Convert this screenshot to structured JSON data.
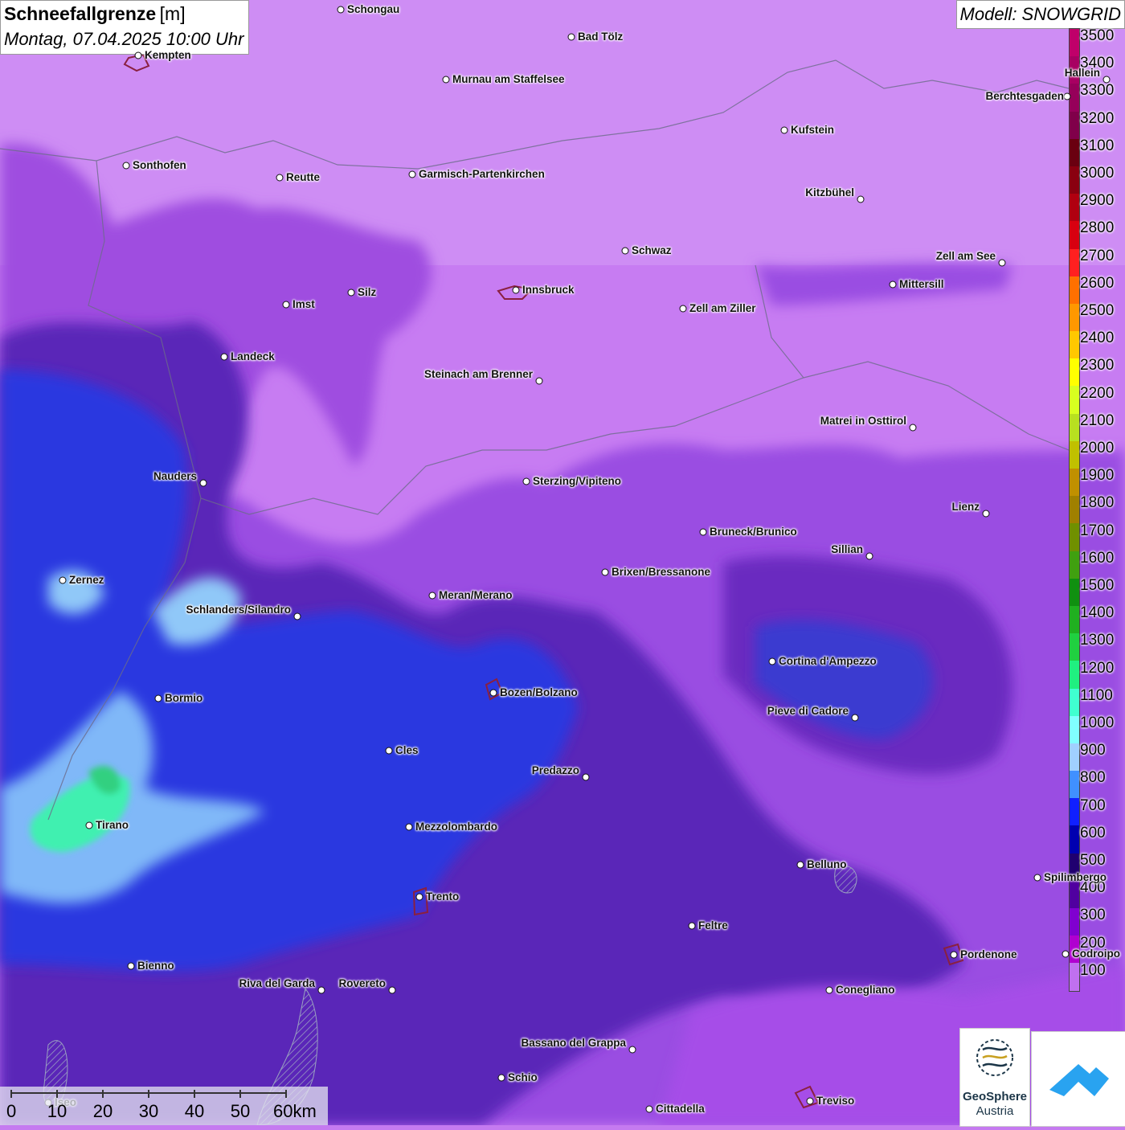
{
  "header": {
    "title": "Schneefallgrenze",
    "unit": "[m]",
    "datetime": "Montag, 07.04.2025 10:00 Uhr"
  },
  "model": {
    "label": "Modell: SNOWGRID"
  },
  "legend": {
    "labels": [
      "3500",
      "3400",
      "3300",
      "3200",
      "3100",
      "3000",
      "2900",
      "2800",
      "2700",
      "2600",
      "2500",
      "2400",
      "2300",
      "2200",
      "2100",
      "2000",
      "1900",
      "1800",
      "1700",
      "1600",
      "1500",
      "1400",
      "1300",
      "1200",
      "1100",
      "1000",
      "900",
      "800",
      "700",
      "600",
      "500",
      "400",
      "300",
      "200",
      "100"
    ],
    "colors": [
      "#c0006a",
      "#a80062",
      "#96005a",
      "#80004a",
      "#6a0010",
      "#8a0010",
      "#b00010",
      "#d80010",
      "#ff2020",
      "#ff7000",
      "#ff9800",
      "#ffc800",
      "#ffff00",
      "#d8ff20",
      "#b8e020",
      "#c0c000",
      "#c09000",
      "#a08000",
      "#709000",
      "#40a010",
      "#109010",
      "#20b020",
      "#20d040",
      "#20f080",
      "#40ffd0",
      "#80ffff",
      "#a0d0ff",
      "#4090ff",
      "#1020ff",
      "#0000b0",
      "#200070",
      "#5000a0",
      "#8000d0",
      "#b000d0",
      "#c070f0"
    ]
  },
  "cities": [
    {
      "name": "Schongau"
    },
    {
      "name": "Bad Tölz"
    },
    {
      "name": "Kempten"
    },
    {
      "name": "Murnau am Staffelsee"
    },
    {
      "name": "Hallein"
    },
    {
      "name": "Berchtesgaden"
    },
    {
      "name": "Kufstein"
    },
    {
      "name": "Sonthofen"
    },
    {
      "name": "Reutte"
    },
    {
      "name": "Garmisch-Partenkirchen"
    },
    {
      "name": "Kitzbühel"
    },
    {
      "name": "Schwaz"
    },
    {
      "name": "Zell am See"
    },
    {
      "name": "Mittersill"
    },
    {
      "name": "Imst"
    },
    {
      "name": "Silz"
    },
    {
      "name": "Innsbruck"
    },
    {
      "name": "Zell am Ziller"
    },
    {
      "name": "Landeck"
    },
    {
      "name": "Steinach am Brenner"
    },
    {
      "name": "Matrei in Osttirol"
    },
    {
      "name": "Nauders"
    },
    {
      "name": "Sterzing/Vipiteno"
    },
    {
      "name": "Lienz"
    },
    {
      "name": "Bruneck/Brunico"
    },
    {
      "name": "Sillian"
    },
    {
      "name": "Zernez"
    },
    {
      "name": "Brixen/Bressanone"
    },
    {
      "name": "Meran/Merano"
    },
    {
      "name": "Schlanders/Silandro"
    },
    {
      "name": "Cortina d'Ampezzo"
    },
    {
      "name": "Bozen/Bolzano"
    },
    {
      "name": "Bormio"
    },
    {
      "name": "Pieve di Cadore"
    },
    {
      "name": "Cles"
    },
    {
      "name": "Predazzo"
    },
    {
      "name": "Tirano"
    },
    {
      "name": "Mezzolombardo"
    },
    {
      "name": "Belluno"
    },
    {
      "name": "Spilimbergo"
    },
    {
      "name": "Trento"
    },
    {
      "name": "Feltre"
    },
    {
      "name": "Pordenone"
    },
    {
      "name": "Codroipo"
    },
    {
      "name": "Bienno"
    },
    {
      "name": "Riva del Garda"
    },
    {
      "name": "Rovereto"
    },
    {
      "name": "Conegliano"
    },
    {
      "name": "Bassano del Grappa"
    },
    {
      "name": "Schio"
    },
    {
      "name": "Treviso"
    },
    {
      "name": "Cittadella"
    },
    {
      "name": "Iseo"
    }
  ],
  "scale_bar": {
    "labels": [
      "0",
      "10",
      "20",
      "30",
      "40",
      "50",
      "60km"
    ]
  },
  "logos": {
    "geosphere_line1": "GeoSphere",
    "geosphere_line2": "Austria"
  }
}
